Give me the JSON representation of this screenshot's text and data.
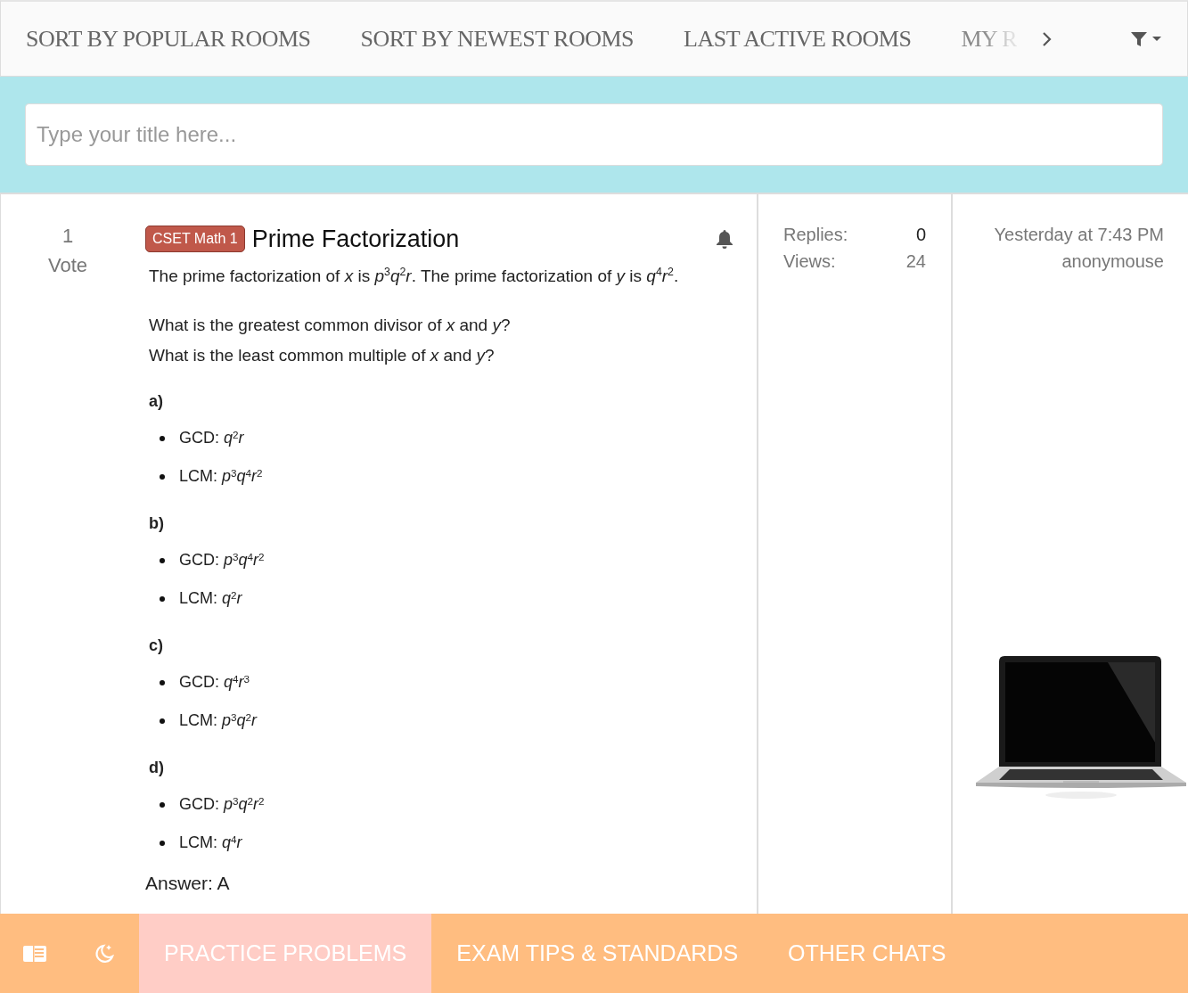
{
  "top_tabs": [
    {
      "label": "SORT BY POPULAR ROOMS",
      "faded": false
    },
    {
      "label": "SORT BY NEWEST ROOMS",
      "faded": false
    },
    {
      "label": "LAST ACTIVE ROOMS",
      "faded": false
    },
    {
      "label": "MY R",
      "faded": true
    }
  ],
  "search": {
    "placeholder": "Type your title here..."
  },
  "post": {
    "votes": "1",
    "vote_label": "Vote",
    "tag": "CSET Math 1",
    "title": "Prime Factorization",
    "paragraphs": [
      "The prime factorization of *x* is *p*$^{3}$*q*$^{2}$*r*. The prime factorization of *y* is *q*$^{4}$*r*$^{2}$.",
      "What is the greatest common divisor of *x* and *y*?",
      "What is the least common multiple of *x* and *y*?"
    ],
    "options": [
      {
        "letter": "a)",
        "items": [
          "GCD: *q*$^{2}$*r*",
          "LCM: *p*$^{3}$*q*$^{4}$*r*$^{2}$"
        ]
      },
      {
        "letter": "b)",
        "items": [
          "GCD: *p*$^{3}$*q*$^{4}$*r*$^{2}$",
          "LCM: *q*$^{2}$*r*"
        ]
      },
      {
        "letter": "c)",
        "items": [
          "GCD: *q*$^{4}$*r*$^{3}$",
          "LCM: *p*$^{3}$*q*$^{2}$*r*"
        ]
      },
      {
        "letter": "d)",
        "items": [
          "GCD: *p*$^{3}$*q*$^{2}$*r*$^{2}$",
          "LCM: *q*$^{4}$*r*"
        ]
      }
    ],
    "answer": "Answer: A",
    "stats": [
      {
        "label": "Replies:",
        "value": "0"
      },
      {
        "label": "Views:",
        "value": "24"
      }
    ],
    "time": "Yesterday at 7:43 PM",
    "author": "anonymouse",
    "media": {
      "kind": "picture"
    }
  },
  "bottom_tabs": [
    {
      "label": "PRACTICE PROBLEMS",
      "selected": true
    },
    {
      "label": "EXAM TIPS & STANDARDS",
      "selected": false
    },
    {
      "label": "OTHER CHATS",
      "selected": false
    }
  ]
}
